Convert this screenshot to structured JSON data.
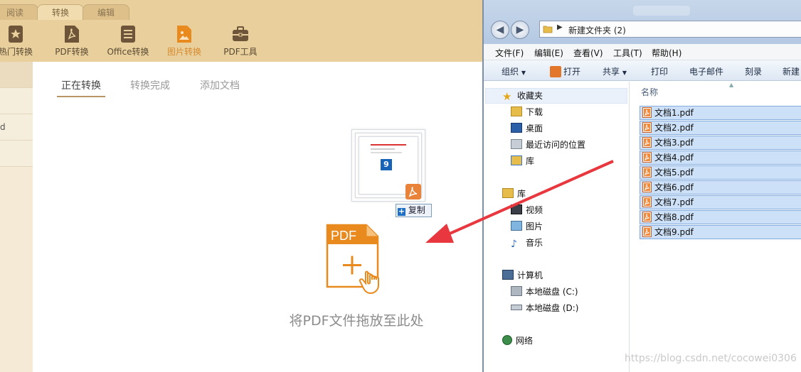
{
  "app": {
    "tabs": [
      {
        "label": "阅读",
        "active": false
      },
      {
        "label": "转换",
        "active": true
      },
      {
        "label": "编辑",
        "active": false
      }
    ],
    "toolbar": [
      {
        "label": "热门转换",
        "icon": "star-doc-icon"
      },
      {
        "label": "PDF转换",
        "icon": "pdf-doc-icon"
      },
      {
        "label": "Office转换",
        "icon": "office-doc-icon"
      },
      {
        "label": "图片转换",
        "icon": "image-doc-icon",
        "active": true
      },
      {
        "label": "PDF工具",
        "icon": "toolbox-icon"
      }
    ],
    "sidebar_items": [
      "",
      "",
      "d",
      ""
    ],
    "subtabs": [
      {
        "label": "正在转换",
        "active": true
      },
      {
        "label": "转换完成",
        "active": false
      },
      {
        "label": "添加文档",
        "active": false
      }
    ],
    "drag": {
      "count": "9",
      "copy_label": "复制"
    },
    "drop": {
      "icon_text": "PDF",
      "message": "将PDF文件拖放至此处"
    }
  },
  "explorer": {
    "address": "新建文件夹 (2)",
    "menu": [
      "文件(F)",
      "编辑(E)",
      "查看(V)",
      "工具(T)",
      "帮助(H)"
    ],
    "commands": [
      "组织",
      "打开",
      "共享",
      "打印",
      "电子邮件",
      "刻录",
      "新建"
    ],
    "nav": {
      "favorites": {
        "label": "收藏夹",
        "items": [
          "下载",
          "桌面",
          "最近访问的位置",
          "库"
        ]
      },
      "libraries": {
        "label": "库",
        "items": [
          "视频",
          "图片",
          "音乐"
        ]
      },
      "computer": {
        "label": "计算机",
        "items": [
          "本地磁盘 (C:)",
          "本地磁盘 (D:)"
        ]
      },
      "network": {
        "label": "网络"
      }
    },
    "column_header": "名称",
    "files": [
      "文档1.pdf",
      "文档2.pdf",
      "文档3.pdf",
      "文档4.pdf",
      "文档5.pdf",
      "文档6.pdf",
      "文档7.pdf",
      "文档8.pdf",
      "文档9.pdf"
    ]
  },
  "watermark": "https://blog.csdn.net/cocowei0306",
  "colors": {
    "accent_orange": "#e98a1f",
    "arrow_red": "#e8373e",
    "selection_blue": "#cce0f7",
    "app_header": "#e8cf9c"
  }
}
